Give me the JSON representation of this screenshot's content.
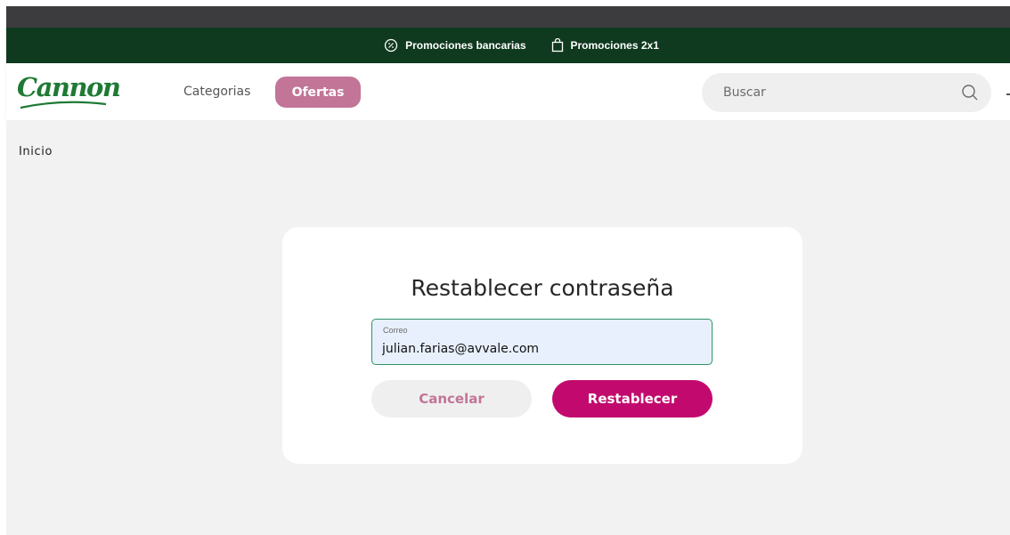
{
  "promo_bar": {
    "items": [
      {
        "label": "Promociones bancarias",
        "icon": "discount-badge-icon"
      },
      {
        "label": "Promociones 2x1",
        "icon": "shopping-bag-icon"
      }
    ]
  },
  "header": {
    "logo_text": "Cannon",
    "nav": {
      "categories_label": "Categorias",
      "offers_label": "Ofertas"
    },
    "search": {
      "placeholder": "Buscar",
      "icon": "search-icon"
    }
  },
  "breadcrumb": {
    "home_label": "Inicio"
  },
  "reset_form": {
    "title": "Restablecer contraseña",
    "email_label": "Correo",
    "email_value": "julian.farias@avvale.com",
    "cancel_label": "Cancelar",
    "submit_label": "Restablecer"
  },
  "colors": {
    "promo_bar_bg": "#0f3a1f",
    "brand_green": "#1e7a34",
    "offers_pink": "#c27596",
    "primary_magenta": "#c20a6e",
    "field_focus_border": "#2e9464"
  }
}
